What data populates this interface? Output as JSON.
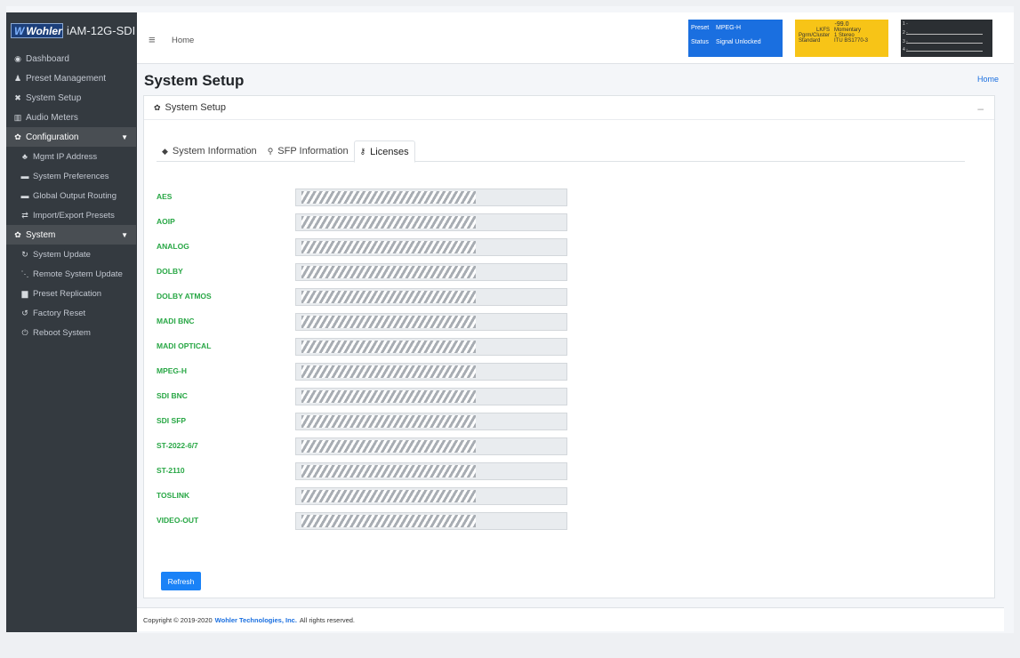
{
  "brand": {
    "logo": "Wohler",
    "title": "iAM-12G-SDI"
  },
  "sidebar": {
    "items": [
      {
        "label": "Dashboard",
        "icon": "tachometer-icon",
        "glyph": "◉"
      },
      {
        "label": "Preset Management",
        "icon": "users-icon",
        "glyph": "♟"
      },
      {
        "label": "System Setup",
        "icon": "tools-icon",
        "glyph": "✖"
      },
      {
        "label": "Audio Meters",
        "icon": "bar-chart-icon",
        "glyph": "▥"
      }
    ],
    "config_group": {
      "label": "Configuration",
      "icon": "gear-icon"
    },
    "config_items": [
      {
        "label": "Mgmt IP Address",
        "icon": "network-icon",
        "glyph": "♣"
      },
      {
        "label": "System Preferences",
        "icon": "keyboard-icon",
        "glyph": "▬"
      },
      {
        "label": "Global Output Routing",
        "icon": "keyboard-icon",
        "glyph": "▬"
      },
      {
        "label": "Import/Export Presets",
        "icon": "exchange-icon",
        "glyph": "⇄"
      }
    ],
    "system_group": {
      "label": "System",
      "icon": "gears-icon"
    },
    "system_items": [
      {
        "label": "System Update",
        "icon": "sync-icon",
        "glyph": "↻"
      },
      {
        "label": "Remote System Update",
        "icon": "project-diagram-icon",
        "glyph": "⋱"
      },
      {
        "label": "Preset Replication",
        "icon": "copy-icon",
        "glyph": "▆"
      },
      {
        "label": "Factory Reset",
        "icon": "undo-icon",
        "glyph": "↺"
      },
      {
        "label": "Reboot System",
        "icon": "power-icon",
        "glyph": "⏻"
      }
    ]
  },
  "topbar": {
    "home": "Home",
    "preset_key": "Preset",
    "preset_val": "MPEG-H",
    "status_key": "Status",
    "status_val": "Signal Unlocked",
    "loudness_value": "-99.0",
    "lkfs_key": "LKFS",
    "lkfs_val": "Momentary",
    "pgm_key": "Pgrm/Cluster",
    "pgm_val": "1   Stereo",
    "std_key": "Standard",
    "std_val": "ITU BS1770-3",
    "meter_labels": [
      "1 -",
      "2 -",
      "3 -",
      "4 -"
    ]
  },
  "page": {
    "title": "System Setup",
    "crumb": "Home",
    "card_title": "System Setup"
  },
  "tabs": [
    {
      "label": "System Information",
      "icon": "tag-icon",
      "glyph": "◆"
    },
    {
      "label": "SFP Information",
      "icon": "plug-icon",
      "glyph": "⚲"
    },
    {
      "label": "Licenses",
      "icon": "key-icon",
      "glyph": "⚷"
    }
  ],
  "licenses": [
    "AES",
    "AOIP",
    "ANALOG",
    "DOLBY",
    "DOLBY ATMOS",
    "MADI BNC",
    "MADI OPTICAL",
    "MPEG-H",
    "SDI BNC",
    "SDI SFP",
    "ST-2022-6/7",
    "ST-2110",
    "TOSLINK",
    "VIDEO-OUT"
  ],
  "refresh_label": "Refresh",
  "footer": {
    "prefix": "Copyright © 2019-2020",
    "company": "Wohler Technologies, Inc.",
    "suffix": "All rights reserved."
  }
}
